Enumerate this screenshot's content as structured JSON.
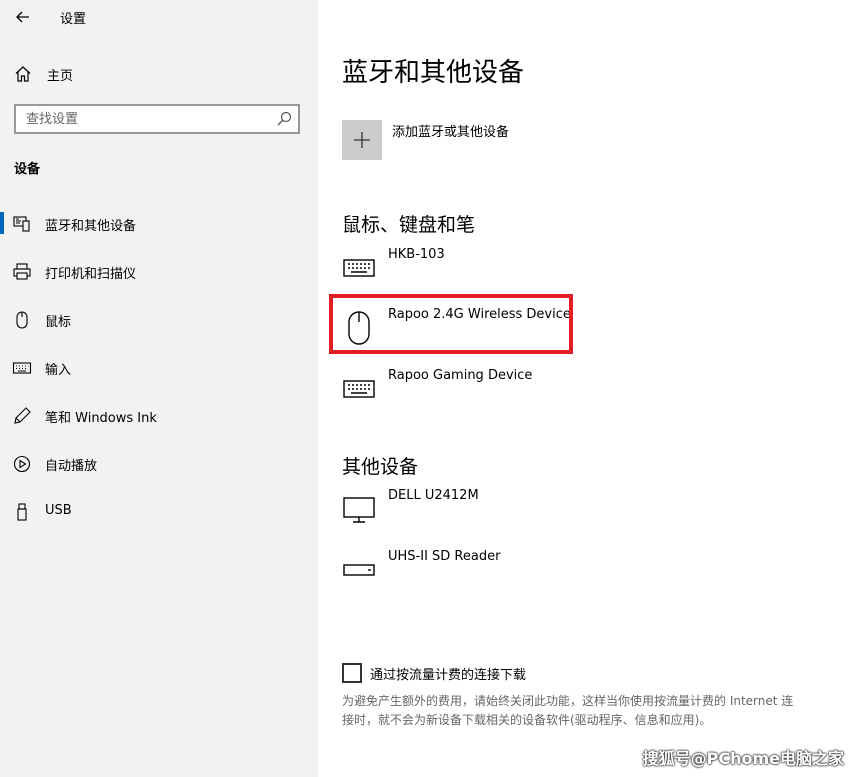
{
  "window": {
    "title": "设置"
  },
  "sidebar": {
    "home_label": "主页",
    "search": {
      "placeholder": "查找设置",
      "value": ""
    },
    "section_heading": "设备",
    "items": [
      {
        "label": "蓝牙和其他设备",
        "icon": "bluetooth-devices-icon",
        "selected": true
      },
      {
        "label": "打印机和扫描仪",
        "icon": "printer-icon",
        "selected": false
      },
      {
        "label": "鼠标",
        "icon": "mouse-icon",
        "selected": false
      },
      {
        "label": "输入",
        "icon": "keyboard-icon",
        "selected": false
      },
      {
        "label": "笔和 Windows Ink",
        "icon": "pen-icon",
        "selected": false
      },
      {
        "label": "自动播放",
        "icon": "autoplay-icon",
        "selected": false
      },
      {
        "label": "USB",
        "icon": "usb-icon",
        "selected": false
      }
    ]
  },
  "main": {
    "title": "蓝牙和其他设备",
    "add_device_label": "添加蓝牙或其他设备",
    "groups": {
      "input": {
        "title": "鼠标、键盘和笔",
        "devices": [
          {
            "name": "HKB-103",
            "icon": "keyboard-icon"
          },
          {
            "name": "Rapoo 2.4G Wireless Device",
            "icon": "mouse-icon"
          },
          {
            "name": "Rapoo Gaming Device",
            "icon": "keyboard-icon"
          }
        ]
      },
      "other": {
        "title": "其他设备",
        "devices": [
          {
            "name": "DELL U2412M",
            "icon": "monitor-icon"
          },
          {
            "name": "UHS-II SD Reader",
            "icon": "drive-icon"
          }
        ]
      }
    },
    "metered": {
      "checkbox_label": "通过按流量计费的连接下载",
      "checked": false,
      "description": "为避免产生额外的费用，请始终关闭此功能，这样当你使用按流量计费的 Internet 连接时，就不会为新设备下载相关的设备软件(驱动程序、信息和应用)。"
    }
  },
  "watermark": "搜狐号@PChome电脑之家",
  "colors": {
    "accent": "#0067c0",
    "highlight": "#e31d24",
    "sidebar_bg": "#f2f2f2"
  }
}
